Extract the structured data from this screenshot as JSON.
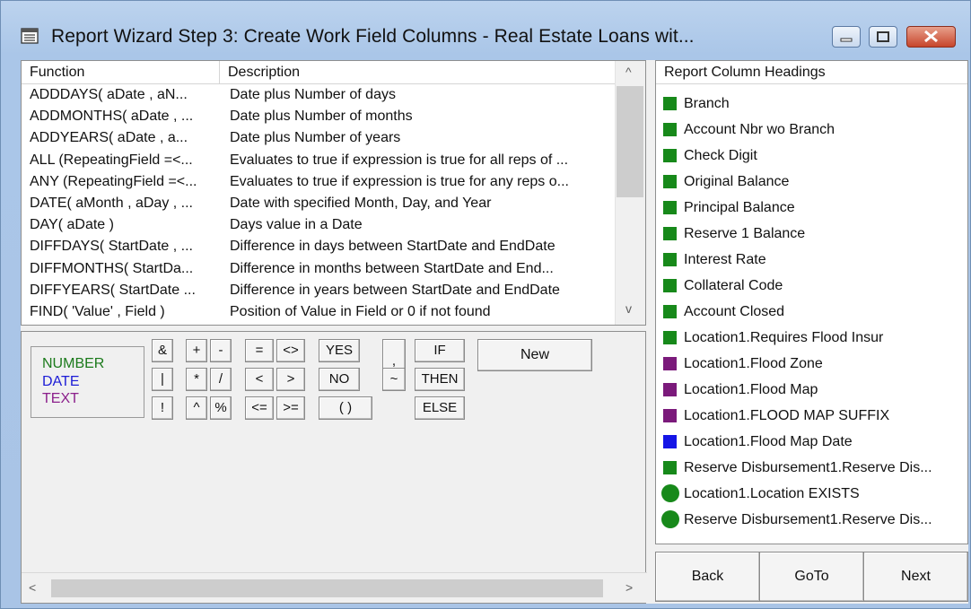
{
  "window": {
    "title": "Report Wizard Step 3:  Create Work Field Columns - Real Estate Loans wit...",
    "icon": "notepad-icon"
  },
  "function_list": {
    "columns": [
      "Function",
      "Description"
    ],
    "rows": [
      {
        "fn": "ADDDAYS( aDate , aN...",
        "desc": "Date plus Number of days"
      },
      {
        "fn": "ADDMONTHS( aDate , ...",
        "desc": "Date plus Number of months"
      },
      {
        "fn": "ADDYEARS( aDate , a...",
        "desc": "Date plus Number of years"
      },
      {
        "fn": "ALL (RepeatingField =<...",
        "desc": "Evaluates to true if expression is true for all reps of ..."
      },
      {
        "fn": "ANY (RepeatingField =<...",
        "desc": "Evaluates to true if expression is true for any reps o..."
      },
      {
        "fn": "DATE( aMonth , aDay , ...",
        "desc": "Date with specified Month, Day, and Year"
      },
      {
        "fn": "DAY( aDate )",
        "desc": "Days value in a Date"
      },
      {
        "fn": "DIFFDAYS( StartDate , ...",
        "desc": "Difference in days between StartDate and EndDate"
      },
      {
        "fn": "DIFFMONTHS( StartDa...",
        "desc": "Difference in months between StartDate and End..."
      },
      {
        "fn": "DIFFYEARS( StartDate ...",
        "desc": "Difference in years between StartDate and EndDate"
      },
      {
        "fn": "FIND( 'Value' , Field )",
        "desc": "Position of Value in Field or 0 if not found"
      }
    ]
  },
  "legend": {
    "number": "NUMBER",
    "date": "DATE",
    "text": "TEXT",
    "colors": {
      "number": "#1b7a1b",
      "date": "#1c1cd6",
      "text": "#8b1f8b"
    }
  },
  "operators": {
    "amp": "&",
    "pipe": "|",
    "bang": "!",
    "plus": "+",
    "star": "*",
    "caret": "^",
    "minus": "-",
    "slash": "/",
    "percent": "%",
    "eq": "=",
    "lt": "<",
    "le": "<=",
    "ne": "<>",
    "gt": ">",
    "ge": ">=",
    "yes": "YES",
    "no": "NO",
    "parens": "( )",
    "comma": ",",
    "tilde": "~",
    "if": "IF",
    "then": "THEN",
    "else": "ELSE",
    "new": "New"
  },
  "headings": {
    "title": "Report Column Headings",
    "items": [
      {
        "label": "Branch",
        "color": "#17891a",
        "shape": "square"
      },
      {
        "label": "Account Nbr wo Branch",
        "color": "#17891a",
        "shape": "square"
      },
      {
        "label": "Check Digit",
        "color": "#17891a",
        "shape": "square"
      },
      {
        "label": "Original Balance",
        "color": "#17891a",
        "shape": "square"
      },
      {
        "label": "Principal Balance",
        "color": "#17891a",
        "shape": "square"
      },
      {
        "label": "Reserve 1 Balance",
        "color": "#17891a",
        "shape": "square"
      },
      {
        "label": "Interest Rate",
        "color": "#17891a",
        "shape": "square"
      },
      {
        "label": "Collateral Code",
        "color": "#17891a",
        "shape": "square"
      },
      {
        "label": "Account Closed",
        "color": "#17891a",
        "shape": "square"
      },
      {
        "label": "Location1.Requires Flood Insur",
        "color": "#17891a",
        "shape": "square"
      },
      {
        "label": "Location1.Flood Zone",
        "color": "#7b1a7b",
        "shape": "square"
      },
      {
        "label": "Location1.Flood Map",
        "color": "#7b1a7b",
        "shape": "square"
      },
      {
        "label": "Location1.FLOOD MAP SUFFIX",
        "color": "#7b1a7b",
        "shape": "square"
      },
      {
        "label": "Location1.Flood Map Date",
        "color": "#1515e6",
        "shape": "square"
      },
      {
        "label": "Reserve Disbursement1.Reserve Dis...",
        "color": "#17891a",
        "shape": "square"
      },
      {
        "label": "Location1.Location EXISTS",
        "color": "#17891a",
        "shape": "circle"
      },
      {
        "label": "Reserve Disbursement1.Reserve Dis...",
        "color": "#17891a",
        "shape": "circle"
      }
    ]
  },
  "nav": {
    "back": "Back",
    "goto": "GoTo",
    "next": "Next"
  },
  "scroll": {
    "up": "^",
    "down": "v",
    "left": "<",
    "right": ">"
  }
}
